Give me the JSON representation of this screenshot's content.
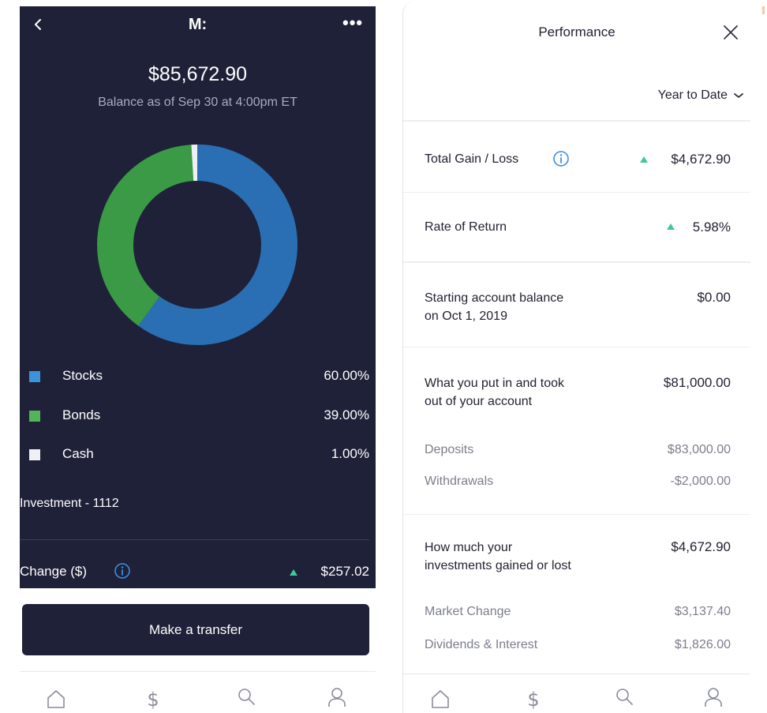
{
  "left_screen": {
    "header": {
      "title": "M:",
      "back_icon": "chevron-left-icon",
      "more_icon": "ellipsis-icon"
    },
    "balance": {
      "amount": "$85,672.90",
      "subtitle": "Balance as of Sep 30 at 4:00pm ET"
    },
    "allocation": [
      {
        "label": "Stocks",
        "value": "60.00%",
        "color": "#3b94d9",
        "fraction": 0.6
      },
      {
        "label": "Bonds",
        "value": "39.00%",
        "color": "#52b55a",
        "fraction": 0.39
      },
      {
        "label": "Cash",
        "value": "1.00%",
        "color": "#eef0f4",
        "fraction": 0.01
      }
    ],
    "account_name": "Investment - 1112",
    "change": {
      "label": "Change ($)",
      "value": "$257.02",
      "indicator_color": "#3fc99b"
    },
    "transfer_button": "Make a transfer",
    "nav_icons": [
      "home-icon",
      "dollar-icon",
      "search-icon",
      "profile-icon"
    ]
  },
  "right_screen": {
    "title": "Performance",
    "close_icon": "close-icon",
    "period": "Year to Date",
    "total_gain": {
      "label": "Total Gain / Loss",
      "value": "$4,672.90"
    },
    "rate_of_return": {
      "label": "Rate of Return",
      "value": "5.98%"
    },
    "starting_balance": {
      "label_line1": "Starting account balance",
      "label_line2": "on Oct 1, 2019",
      "value": "$0.00"
    },
    "contributions": {
      "label_line1": "What you put in and took",
      "label_line2": "out of your account",
      "value": "$81,000.00",
      "deposits_label": "Deposits",
      "deposits_value": "$83,000.00",
      "withdrawals_label": "Withdrawals",
      "withdrawals_value": "-$2,000.00"
    },
    "investment_gain": {
      "label_line1": "How much your",
      "label_line2": "investments gained or lost",
      "value": "$4,672.90",
      "market_label": "Market Change",
      "market_value": "$3,137.40",
      "dividends_label": "Dividends & Interest",
      "dividends_value": "$1,826.00"
    },
    "nav_icons": [
      "home-icon",
      "dollar-icon",
      "search-icon",
      "profile-icon"
    ],
    "accent_green": "#3fc99b"
  }
}
